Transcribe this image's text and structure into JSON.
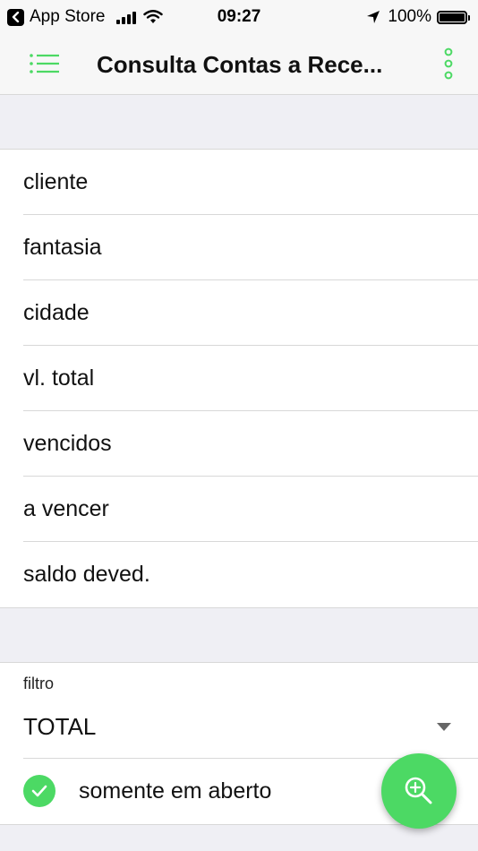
{
  "status_bar": {
    "back_app": "App Store",
    "time": "09:27",
    "battery": "100%"
  },
  "nav": {
    "title": "Consulta Contas a Rece...",
    "menu_icon": "menu-list-icon",
    "more_icon": "more-vertical-icon"
  },
  "list": {
    "items": [
      {
        "label": "cliente"
      },
      {
        "label": "fantasia"
      },
      {
        "label": "cidade"
      },
      {
        "label": "vl. total"
      },
      {
        "label": "vencidos"
      },
      {
        "label": "a vencer"
      },
      {
        "label": "saldo deved."
      }
    ]
  },
  "filter": {
    "label": "filtro",
    "value": "TOTAL",
    "checkbox_label": "somente em aberto",
    "checkbox_checked": true
  },
  "colors": {
    "accent": "#4cd964",
    "background": "#efeff4"
  },
  "fab": {
    "icon": "zoom-in-icon"
  }
}
